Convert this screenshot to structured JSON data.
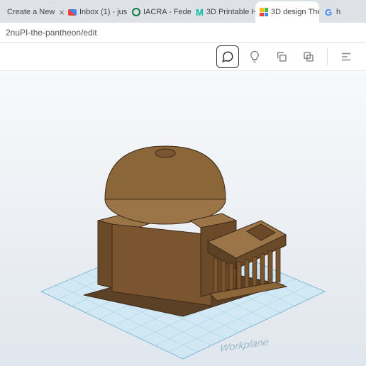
{
  "tabs": [
    {
      "label": "Create a New",
      "favicon": "blank"
    },
    {
      "label": "Inbox (1) - jus",
      "favicon": "gmail"
    },
    {
      "label": "IACRA - Feder",
      "favicon": "iacra"
    },
    {
      "label": "3D Printable H",
      "favicon": "m"
    },
    {
      "label": "3D design The",
      "favicon": "tinkercad",
      "active": true
    },
    {
      "label": "h",
      "favicon": "google"
    }
  ],
  "url": "2nuPI-the-pantheon/edit",
  "workplane_label": "Workplane",
  "tools": {
    "comment": "comment",
    "bulb": "bulb",
    "copy": "copy",
    "paste": "paste"
  }
}
